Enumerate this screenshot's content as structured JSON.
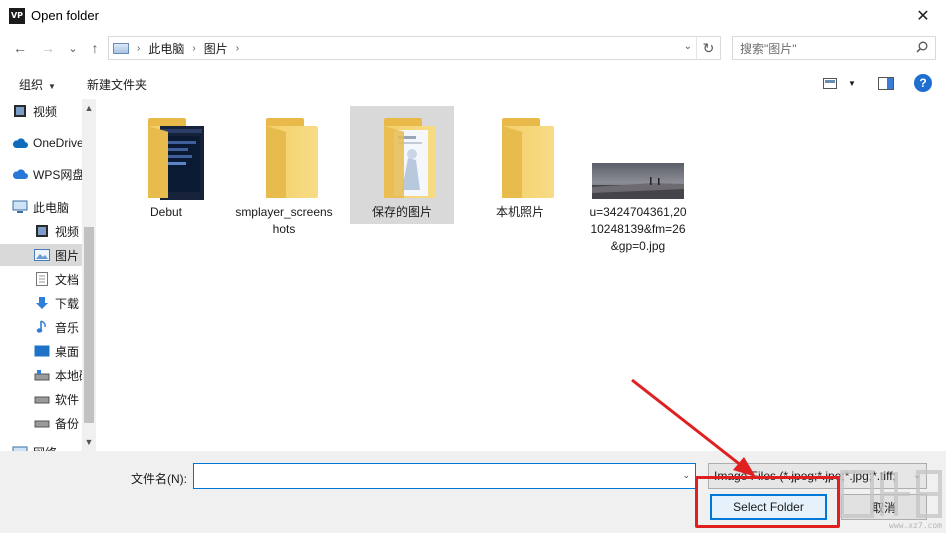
{
  "window": {
    "app_icon_text": "VP",
    "title": "Open folder",
    "close_glyph": "✕"
  },
  "nav": {
    "back_glyph": "←",
    "forward_glyph": "→",
    "recent_glyph": "⌄",
    "up_glyph": "↑",
    "breadcrumbs": [
      "此电脑",
      "图片"
    ],
    "crumb_sep": "›",
    "address_drop_glyph": "⌄",
    "refresh_glyph": "↻",
    "search_placeholder": "搜索\"图片\""
  },
  "toolbar": {
    "organize_label": "组织",
    "organize_caret": "▼",
    "new_folder_label": "新建文件夹",
    "view_caret": "▼",
    "help_glyph": "?"
  },
  "sidebar": {
    "items": [
      {
        "label": "视频",
        "icon": "video-icon"
      },
      {
        "label": "OneDrive",
        "icon": "cloud-icon"
      },
      {
        "label": "WPS网盘",
        "icon": "wps-cloud-icon"
      },
      {
        "label": "此电脑",
        "icon": "computer-icon"
      },
      {
        "label": "视频",
        "icon": "video-icon"
      },
      {
        "label": "图片",
        "icon": "pictures-icon",
        "selected": true
      },
      {
        "label": "文档",
        "icon": "document-icon"
      },
      {
        "label": "下载",
        "icon": "download-icon"
      },
      {
        "label": "音乐",
        "icon": "music-icon"
      },
      {
        "label": "桌面",
        "icon": "desktop-icon"
      },
      {
        "label": "本地磁盘",
        "icon": "drive-icon"
      },
      {
        "label": "软件",
        "icon": "drive-icon"
      },
      {
        "label": "备份",
        "icon": "drive-icon"
      },
      {
        "label": "网络",
        "icon": "network-icon"
      }
    ],
    "scroll_up_glyph": "▲",
    "scroll_down_glyph": "▼"
  },
  "files": [
    {
      "label": "Debut",
      "kind": "folder-with-screenshot"
    },
    {
      "label": "smplayer_screenshots",
      "kind": "folder"
    },
    {
      "label": "保存的图片",
      "kind": "folder-with-document",
      "selected": true
    },
    {
      "label": "本机照片",
      "kind": "folder"
    },
    {
      "label": "u=3424704361,2010248139&fm=26&gp=0.jpg",
      "kind": "image"
    }
  ],
  "bottom": {
    "filename_label": "文件名(N):",
    "filename_value": "",
    "filename_drop_glyph": "⌄",
    "filter_value": "Image Files (*.jpeg;*.jpe;*.jpg;*.tiff;",
    "filter_drop_glyph": "⌄",
    "select_button": "Select Folder",
    "cancel_button": "取消"
  },
  "watermark": {
    "text": "www.xz7.com"
  },
  "colors": {
    "accent": "#0078d7",
    "annotation_red": "#e02020",
    "folder_yellow": "#f3cf68",
    "selection_gray": "#d9d9d9"
  }
}
